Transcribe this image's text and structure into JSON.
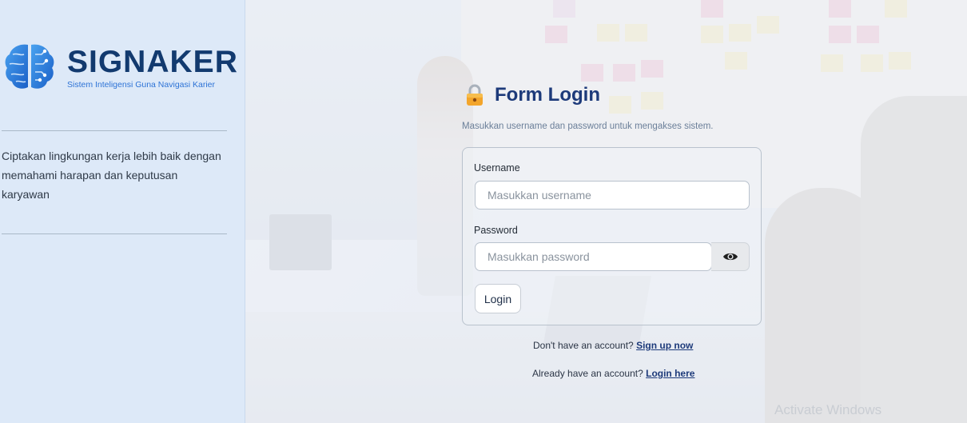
{
  "sidebar": {
    "brand_name": "SIGNAKER",
    "brand_tagline": "Sistem Inteligensi Guna Navigasi Karier",
    "description": "Ciptakan lingkungan kerja lebih baik dengan memahami harapan dan keputusan karyawan"
  },
  "login": {
    "title": "Form Login",
    "subtitle": "Masukkan username dan password untuk mengakses sistem.",
    "username_label": "Username",
    "username_placeholder": "Masukkan username",
    "password_label": "Password",
    "password_placeholder": "Masukkan password",
    "login_button": "Login",
    "signup_prompt": "Don't have an account?",
    "signup_link": "Sign up now",
    "login_prompt": "Already have an account?",
    "login_link": "Login here"
  },
  "watermark": "Activate Windows",
  "colors": {
    "brand_dark": "#123a6f",
    "brand_blue": "#2d73d6",
    "title_navy": "#1d3a7a",
    "sidebar_bg": "#dde9f8"
  }
}
